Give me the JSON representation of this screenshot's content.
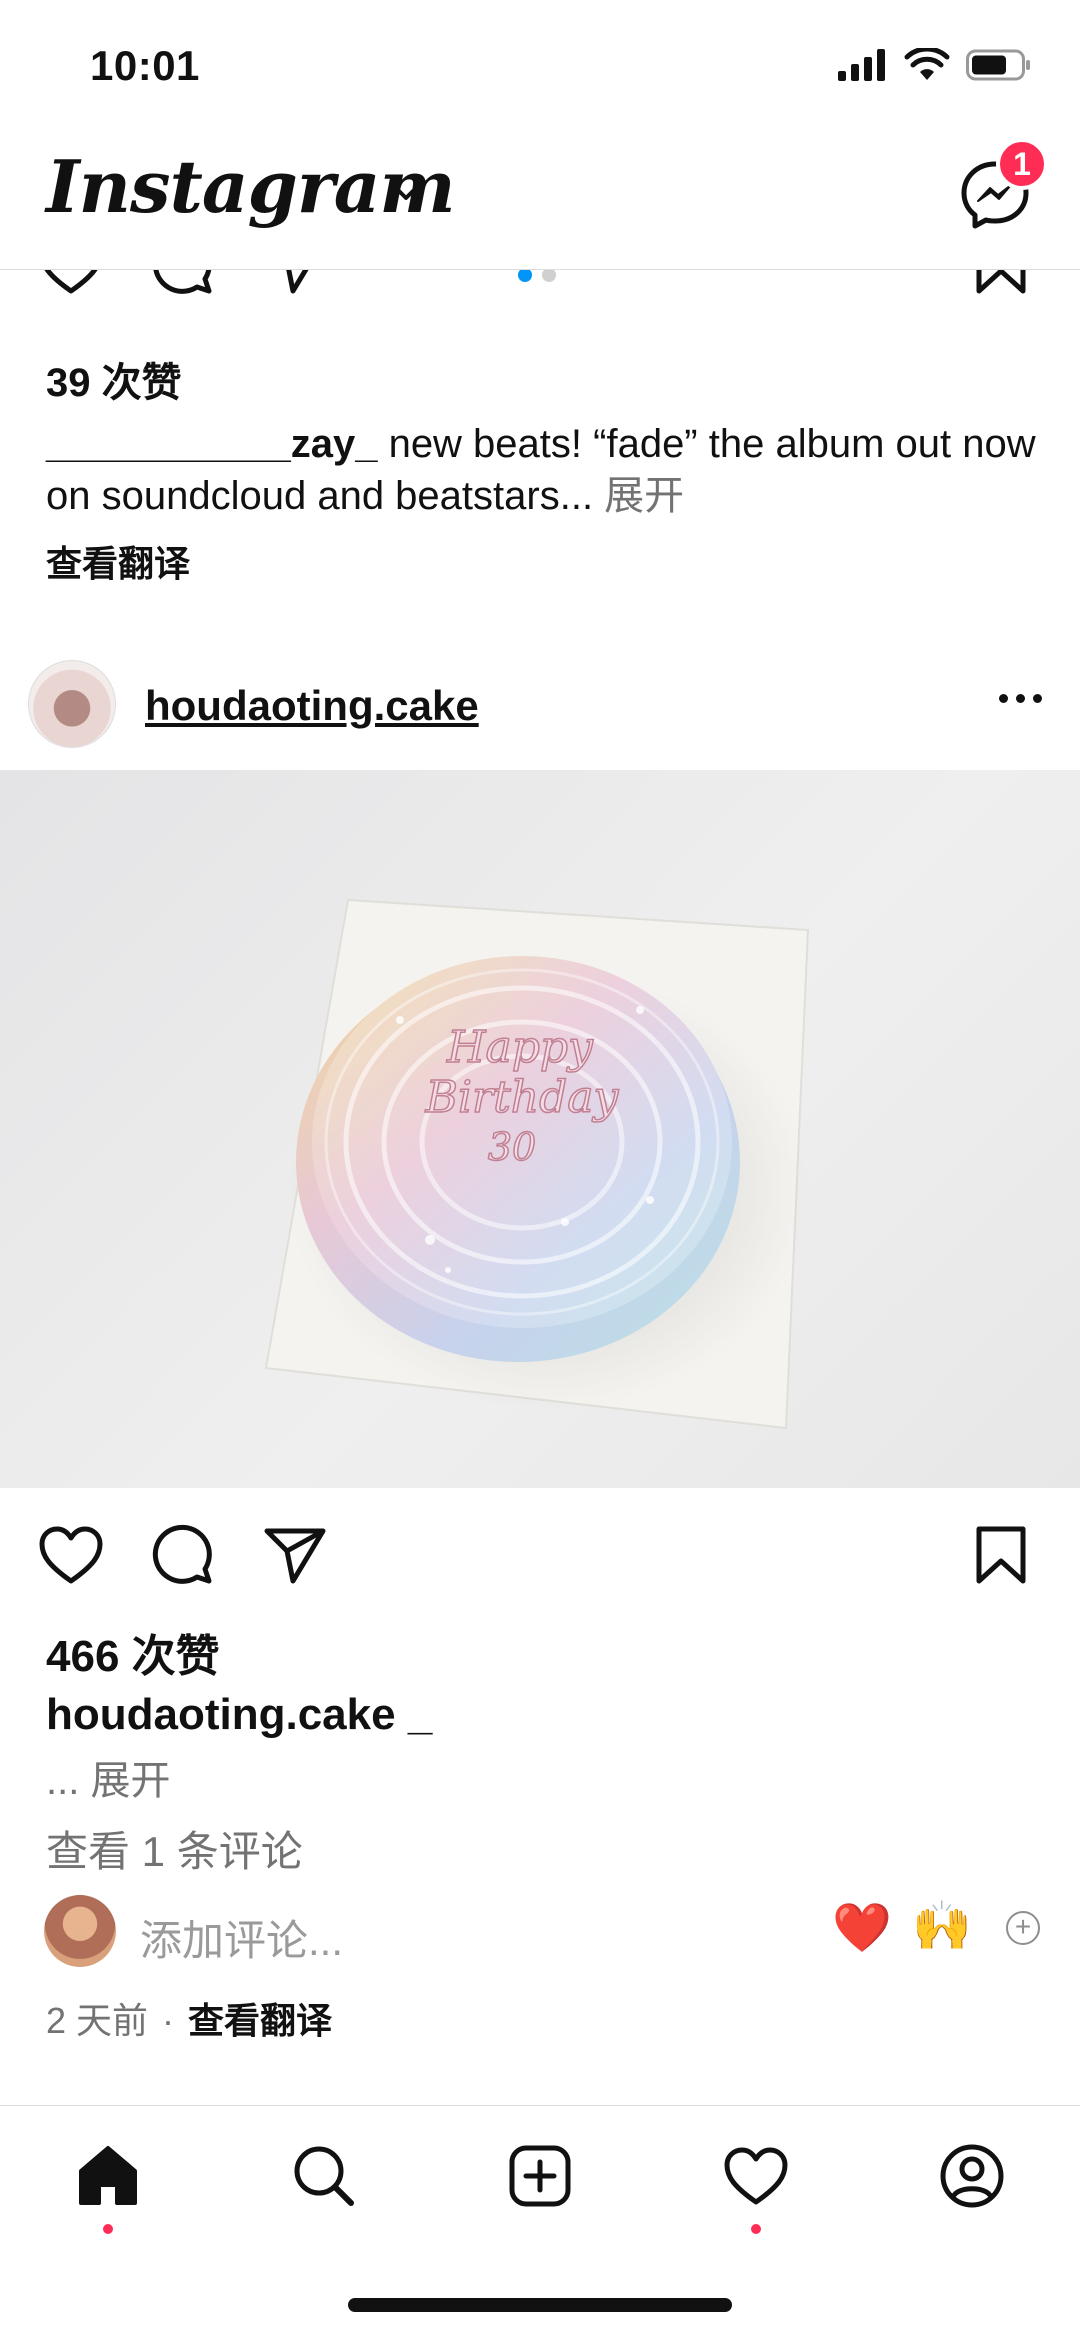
{
  "status_bar": {
    "time": "10:01"
  },
  "header": {
    "logo": "Instagram",
    "messenger_badge": "1"
  },
  "prev_post": {
    "likes": "39 次赞",
    "username": "___________zay_",
    "caption": " new beats! “fade” the album out now on soundcloud and beatstars...",
    "more": " 展开",
    "translate": "查看翻译"
  },
  "post": {
    "username": "houdaoting.cake",
    "cake_text": [
      "Happy",
      "Birthday",
      "30"
    ],
    "likes": "466 次赞",
    "caption_user": "houdaoting.cake _",
    "more": "... 展开",
    "view_comments": "查看 1 条评论",
    "add_comment_placeholder": "添加评论...",
    "time": "2 天前",
    "separator": "·",
    "translate": "查看翻译"
  },
  "quick_emojis": [
    "❤️",
    "🙌"
  ],
  "colors": {
    "accent_blue": "#0095f6",
    "badge_red": "#ff2d55"
  },
  "nav": {
    "items": [
      "home-icon",
      "search-icon",
      "create-icon",
      "activity-icon",
      "profile-icon"
    ]
  }
}
